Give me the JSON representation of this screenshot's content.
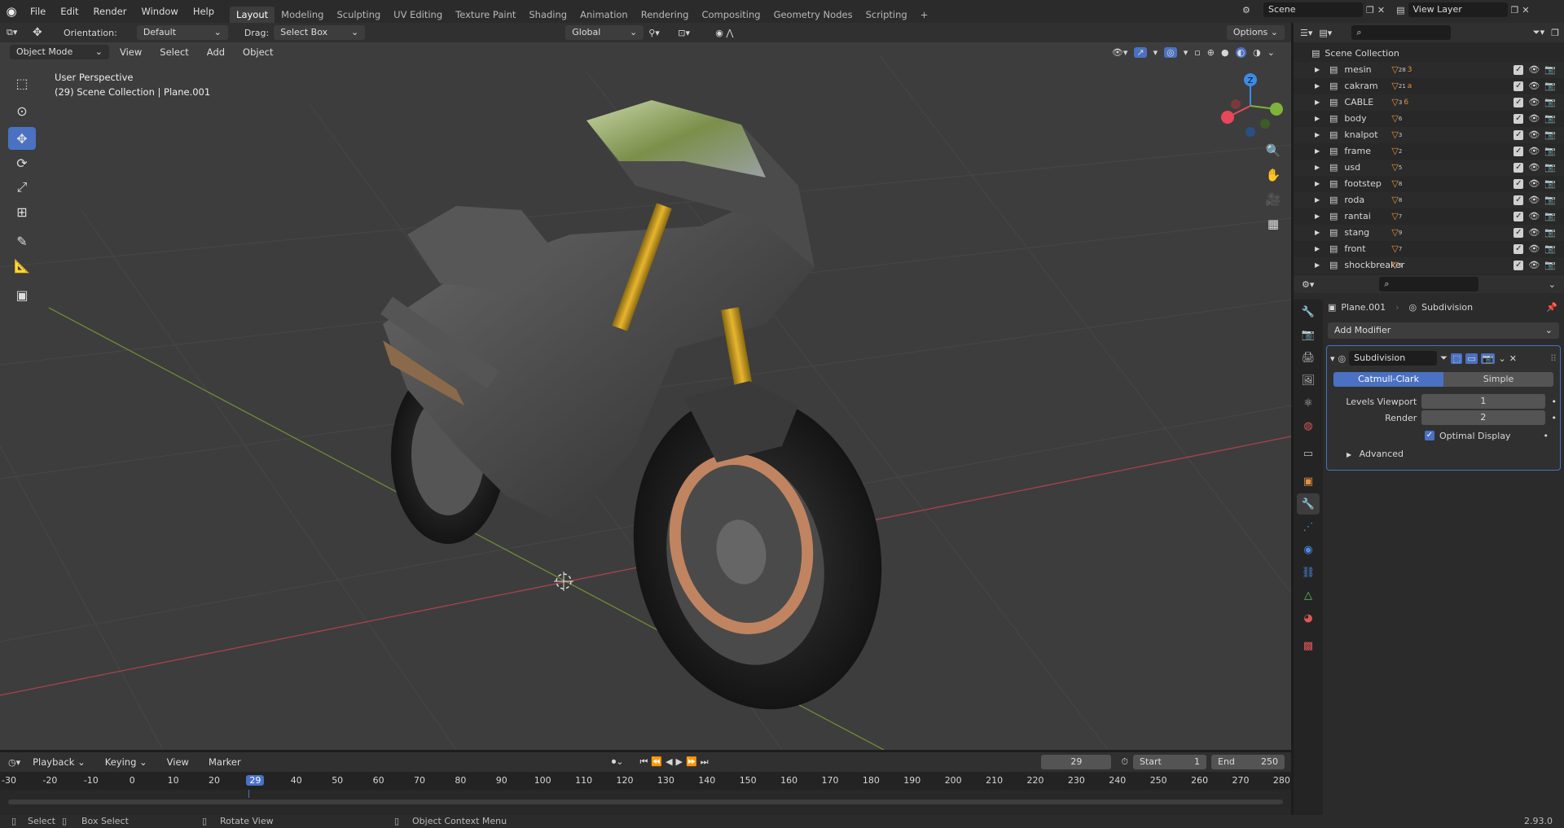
{
  "app": {
    "logo": "blender-logo-icon"
  },
  "menu": [
    "File",
    "Edit",
    "Render",
    "Window",
    "Help"
  ],
  "workspaces": [
    "Layout",
    "Modeling",
    "Sculpting",
    "UV Editing",
    "Texture Paint",
    "Shading",
    "Animation",
    "Rendering",
    "Compositing",
    "Geometry Nodes",
    "Scripting"
  ],
  "workspace_add": "+",
  "scene": {
    "name": "Scene",
    "view_layer": "View Layer"
  },
  "tool_settings": {
    "orientation_label": "Orientation:",
    "orientation_value": "Default",
    "drag_label": "Drag:",
    "drag_value": "Select Box",
    "transform_orientation": "Global",
    "options_label": "Options"
  },
  "viewport_header": {
    "mode": "Object Mode",
    "menus": [
      "View",
      "Select",
      "Add",
      "Object"
    ]
  },
  "viewport_overlay": {
    "perspective": "User Perspective",
    "collection_info": "(29) Scene Collection | Plane.001"
  },
  "gizmo": {
    "z": "Z",
    "y": "Y",
    "x": "X"
  },
  "outliner": {
    "root": "Scene Collection",
    "collections": [
      {
        "name": "mesin",
        "badge": "28",
        "badge2": "3"
      },
      {
        "name": "cakram",
        "badge": "21",
        "badge2": "a"
      },
      {
        "name": "CABLE",
        "badge": "3",
        "badge2": "6"
      },
      {
        "name": "body",
        "badge": "6",
        "badge2": ""
      },
      {
        "name": "knalpot",
        "badge": "3",
        "badge2": ""
      },
      {
        "name": "frame",
        "badge": "2",
        "badge2": ""
      },
      {
        "name": "usd",
        "badge": "5",
        "badge2": ""
      },
      {
        "name": "footstep",
        "badge": "8",
        "badge2": ""
      },
      {
        "name": "roda",
        "badge": "8",
        "badge2": ""
      },
      {
        "name": "rantai",
        "badge": "7",
        "badge2": ""
      },
      {
        "name": "stang",
        "badge": "9",
        "badge2": ""
      },
      {
        "name": "front",
        "badge": "7",
        "badge2": ""
      },
      {
        "name": "shockbreaker",
        "badge": "5",
        "badge2": ""
      }
    ]
  },
  "properties": {
    "object_name": "Plane.001",
    "modifier_breadcrumb": "Subdivision",
    "add_modifier": "Add Modifier",
    "modifier": {
      "name": "Subdivision",
      "type_options": [
        "Catmull-Clark",
        "Simple"
      ],
      "active_type": "Catmull-Clark",
      "levels_viewport_label": "Levels Viewport",
      "levels_viewport": "1",
      "render_label": "Render",
      "render": "2",
      "optimal_display_label": "Optimal Display",
      "optimal_display": true,
      "advanced_label": "Advanced"
    }
  },
  "timeline": {
    "menus": [
      "Playback",
      "Keying",
      "View",
      "Marker"
    ],
    "current_frame": "29",
    "start_label": "Start",
    "start": "1",
    "end_label": "End",
    "end": "250",
    "ruler": [
      "-30",
      "-20",
      "-10",
      "0",
      "10",
      "20",
      "29",
      "40",
      "50",
      "60",
      "70",
      "80",
      "90",
      "100",
      "110",
      "120",
      "130",
      "140",
      "150",
      "160",
      "170",
      "180",
      "190",
      "200",
      "210",
      "220",
      "230",
      "240",
      "250",
      "260",
      "270",
      "280"
    ]
  },
  "statusbar": {
    "select": "Select",
    "box_select": "Box Select",
    "rotate_view": "Rotate View",
    "context_menu": "Object Context Menu",
    "version": "2.93.0"
  },
  "colors": {
    "accent": "#4a71c2",
    "axis_x": "#e8475a",
    "axis_y": "#7fb33a",
    "axis_z": "#3c8be8",
    "orange": "#e0913f"
  }
}
